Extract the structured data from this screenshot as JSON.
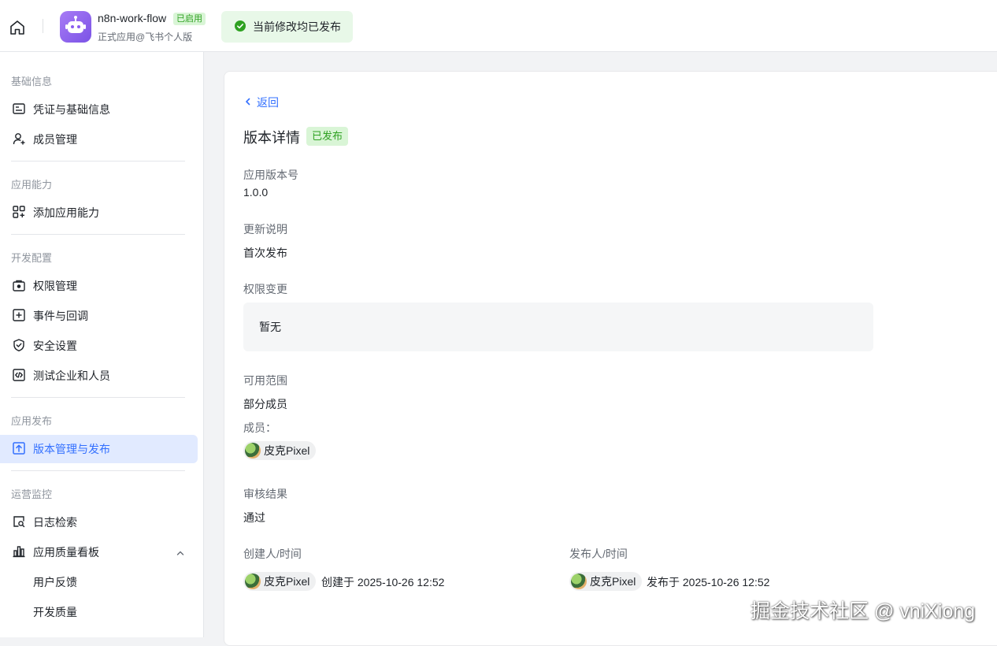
{
  "header": {
    "app_name": "n8n-work-flow",
    "enabled_badge": "已启用",
    "app_subtitle": "正式应用@飞书个人版",
    "publish_status": "当前修改均已发布"
  },
  "sidebar": {
    "groups": [
      {
        "title": "基础信息",
        "items": [
          {
            "label": "凭证与基础信息",
            "icon": "credential-icon"
          },
          {
            "label": "成员管理",
            "icon": "user-add-icon"
          }
        ]
      },
      {
        "title": "应用能力",
        "items": [
          {
            "label": "添加应用能力",
            "icon": "apps-add-icon"
          }
        ]
      },
      {
        "title": "开发配置",
        "items": [
          {
            "label": "权限管理",
            "icon": "permission-icon"
          },
          {
            "label": "事件与回调",
            "icon": "event-icon"
          },
          {
            "label": "安全设置",
            "icon": "shield-icon"
          },
          {
            "label": "测试企业和人员",
            "icon": "code-icon"
          }
        ]
      },
      {
        "title": "应用发布",
        "items": [
          {
            "label": "版本管理与发布",
            "icon": "upload-icon",
            "active": true
          }
        ]
      },
      {
        "title": "运营监控",
        "items": [
          {
            "label": "日志检索",
            "icon": "log-search-icon"
          },
          {
            "label": "应用质量看板",
            "icon": "bar-chart-icon"
          },
          {
            "label": "用户反馈"
          },
          {
            "label": "开发质量"
          }
        ]
      }
    ]
  },
  "detail": {
    "back_label": "返回",
    "title": "版本详情",
    "status_badge": "已发布",
    "version_label": "应用版本号",
    "version_value": "1.0.0",
    "notes_label": "更新说明",
    "notes_value": "首次发布",
    "permission_label": "权限变更",
    "permission_value": "暂无",
    "scope_label": "可用范围",
    "scope_value": "部分成员",
    "members_label": "成员：",
    "member_name": "皮克Pixel",
    "review_label": "审核结果",
    "review_value": "通过",
    "creator_label": "创建人/时间",
    "creator_name": "皮克Pixel",
    "created_text": "创建于 2025-10-26 12:52",
    "publisher_label": "发布人/时间",
    "publisher_name": "皮克Pixel",
    "published_text": "发布于 2025-10-26 12:52"
  },
  "watermark": "掘金技术社区 @ vniXiong",
  "colors": {
    "accent": "#3370ff",
    "success": "#2ea121",
    "success_bg": "#d9f5d6"
  }
}
